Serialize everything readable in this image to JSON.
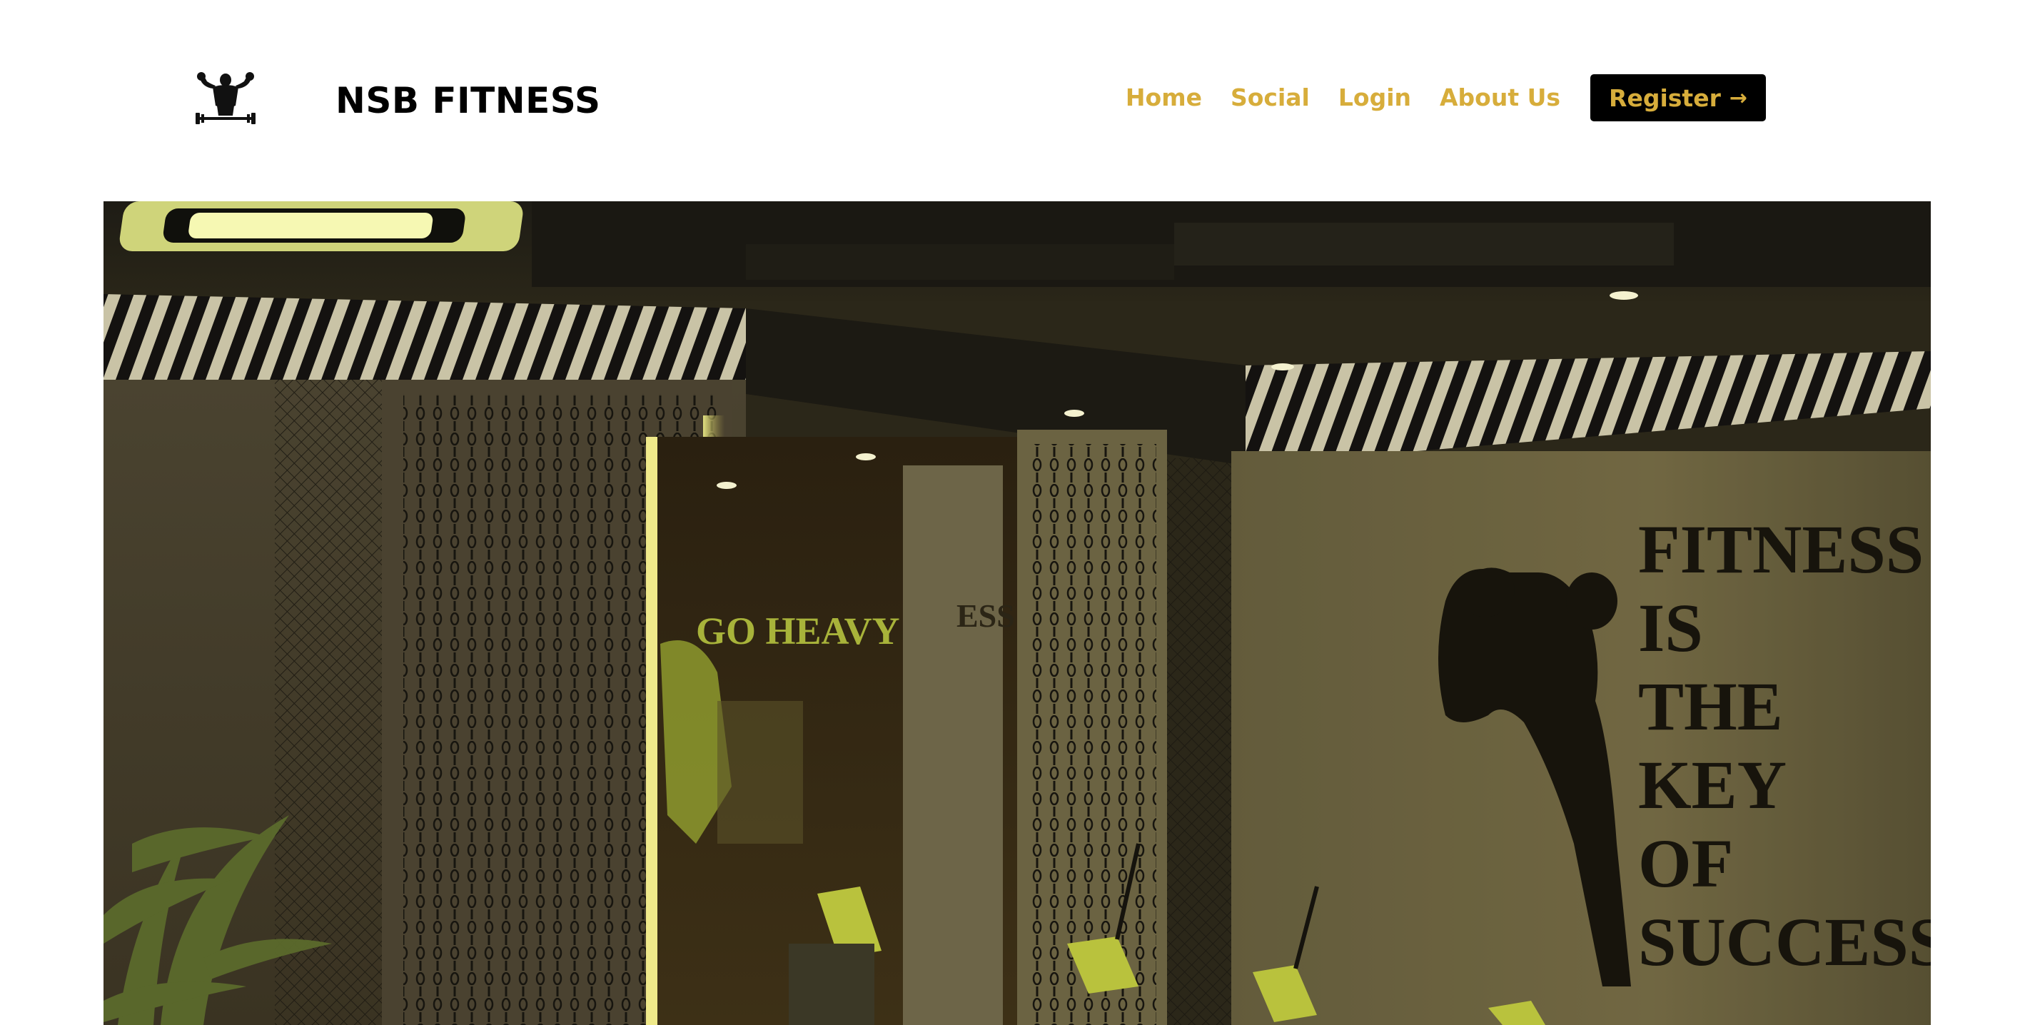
{
  "header": {
    "brand_name": "NSB FITNESS",
    "logo_icon": "bodybuilder-barbell-logo-icon",
    "nav": {
      "home": "Home",
      "social": "Social",
      "login": "Login",
      "about": "About Us",
      "register": "Register",
      "register_icon": "arrow-right-icon"
    },
    "colors": {
      "accent": "#d7ad3b",
      "button_bg": "#000000",
      "brand": "#000000"
    }
  },
  "hero": {
    "wall_text_lines": [
      "FITNESS",
      "IS",
      "THE",
      "KEY",
      "OF",
      "SUCCESS"
    ],
    "back_wall_text": "GO HEAVY",
    "mirror_text": "ESS"
  }
}
